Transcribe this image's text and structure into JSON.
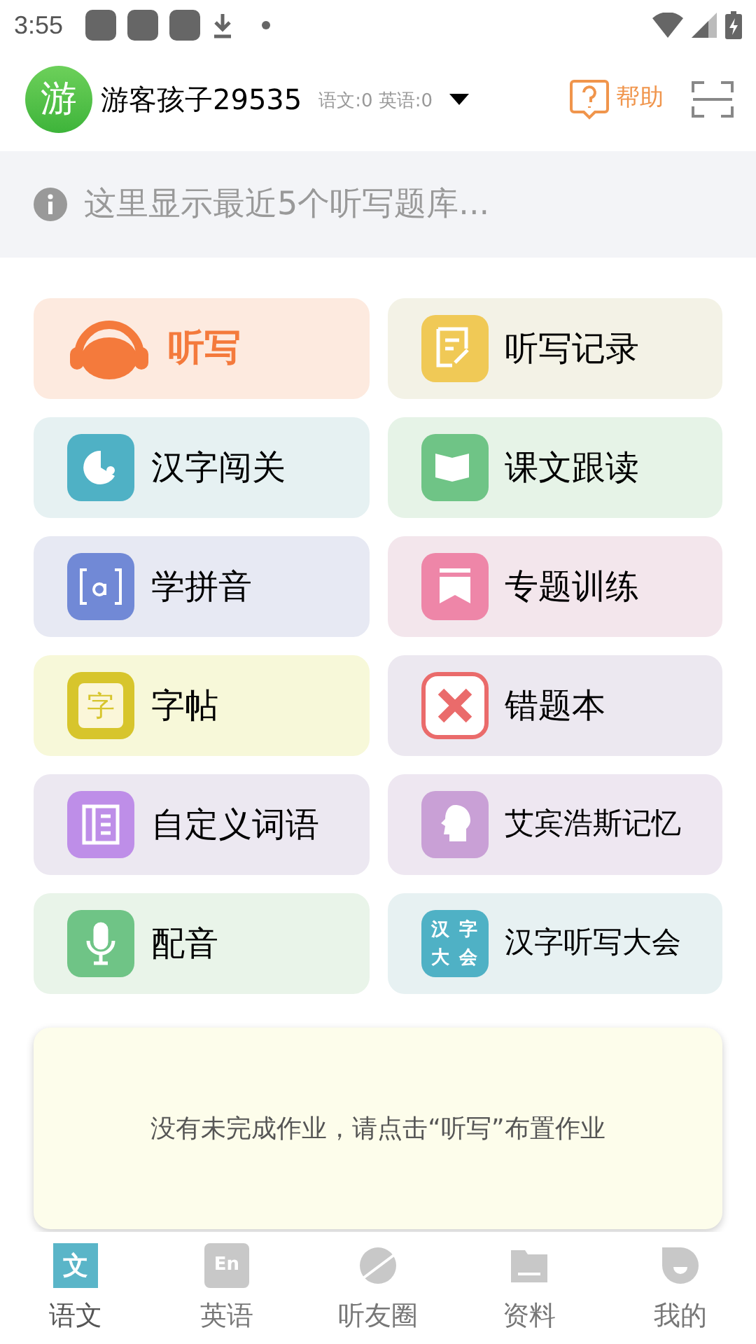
{
  "status_bar": {
    "time": "3:55"
  },
  "header": {
    "avatar": "游",
    "username": "游客孩子29535",
    "scores": "语文:0 英语:0",
    "help": "帮助"
  },
  "notice": "这里显示最近5个听写题库...",
  "cards": [
    {
      "kind": "headset",
      "label": "听写",
      "color": "#f47a3c"
    },
    {
      "kind": "record",
      "label": "听写记录",
      "color": "#f0c956"
    },
    {
      "kind": "game",
      "label": "汉字闯关",
      "color": "#4fb1c5"
    },
    {
      "kind": "book",
      "label": "课文跟读",
      "color": "#6fc486"
    },
    {
      "kind": "pinyin",
      "label": "学拼音",
      "color": "#7189d6"
    },
    {
      "kind": "bookmark",
      "label": "专题训练",
      "color": "#ee86a8"
    },
    {
      "kind": "glyph",
      "label": "字帖",
      "color": "#d7c52c",
      "icon_text": "字"
    },
    {
      "kind": "wrong",
      "label": "错题本",
      "color": "#ea6b6b"
    },
    {
      "kind": "list",
      "label": "自定义词语",
      "color": "#be8ee8"
    },
    {
      "kind": "head",
      "label": "艾宾浩斯记忆",
      "color": "#c9a0d6"
    },
    {
      "kind": "mic",
      "label": "配音",
      "color": "#6fc486"
    },
    {
      "kind": "contest",
      "label": "汉字听写大会",
      "color": "#4fb1c5",
      "icon_text": "汉字大会"
    }
  ],
  "homework": "没有未完成作业，请点击“听写”布置作业",
  "tabs": [
    {
      "kind": "chinese",
      "label": "语文",
      "icon_text": "文",
      "selected": true
    },
    {
      "kind": "english",
      "label": "英语",
      "icon_text": "En",
      "selected": false
    },
    {
      "kind": "circle",
      "label": "听友圈",
      "selected": false
    },
    {
      "kind": "folder",
      "label": "资料",
      "selected": false
    },
    {
      "kind": "me",
      "label": "我的",
      "selected": false
    }
  ]
}
